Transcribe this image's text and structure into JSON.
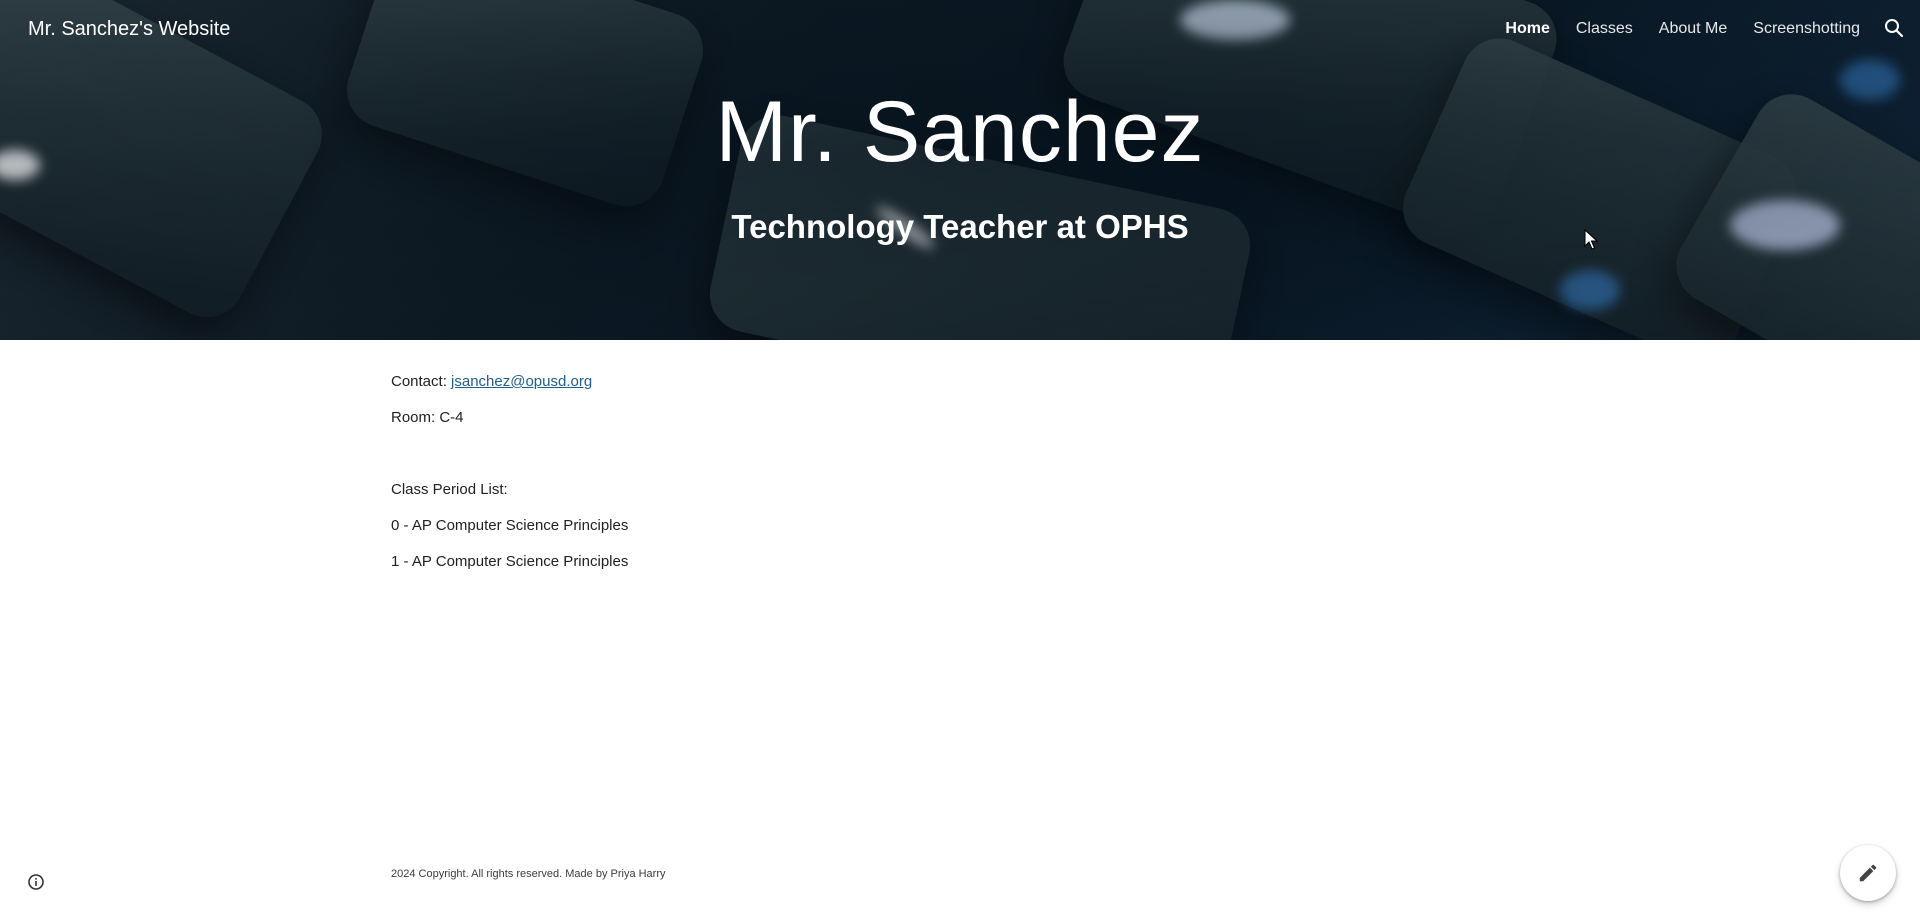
{
  "header": {
    "site_title": "Mr. Sanchez's Website",
    "nav": [
      "Home",
      "Classes",
      "About Me",
      "Screenshotting"
    ],
    "active_nav": "Home",
    "search_icon": "search-icon"
  },
  "hero": {
    "title": "Mr. Sanchez",
    "subtitle": "Technology Teacher at OPHS"
  },
  "main": {
    "contact_label": "Contact: ",
    "contact_email": "jsanchez@opusd.org",
    "room": "Room: C-4",
    "class_list_heading": "Class Period List:",
    "periods": [
      "0 - AP Computer Science Principles",
      "1 - AP Computer Science Principles"
    ]
  },
  "footer": {
    "copyright": "2024 Copyright. All rights reserved. Made by Priya Harry",
    "info_icon": "info-icon",
    "edit_icon": "pencil-icon"
  },
  "colors": {
    "link": "#1f5f88",
    "hero_bg": "#0e1a24",
    "text": "#212121"
  }
}
